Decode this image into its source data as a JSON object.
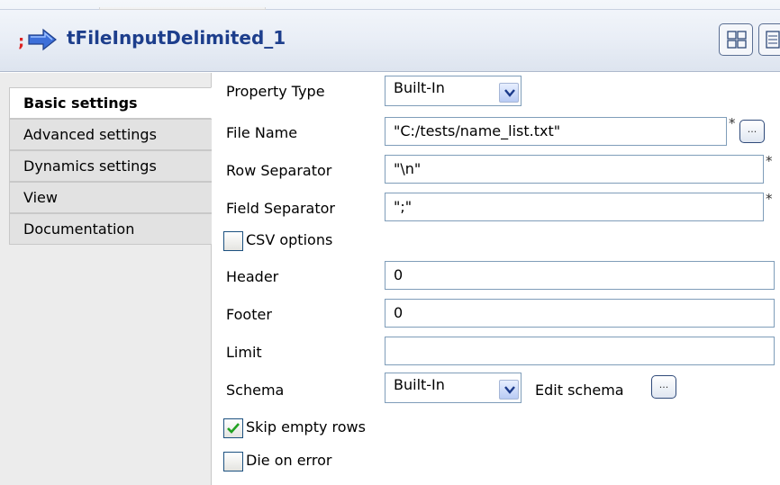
{
  "component": {
    "title": "tFileInputDelimited_1",
    "icon": "file-input-delimited-icon"
  },
  "nav": {
    "items": [
      {
        "label": "Basic settings",
        "active": true
      },
      {
        "label": "Advanced settings",
        "active": false
      },
      {
        "label": "Dynamics settings",
        "active": false
      },
      {
        "label": "View",
        "active": false
      },
      {
        "label": "Documentation",
        "active": false
      }
    ]
  },
  "form": {
    "property_type": {
      "label": "Property Type",
      "value": "Built-In"
    },
    "file_name": {
      "label": "File Name",
      "value": "\"C:/tests/name_list.txt\"",
      "required": "*",
      "browse": "..."
    },
    "row_separator": {
      "label": "Row Separator",
      "value": "\"\\n\"",
      "required": "*"
    },
    "field_separator": {
      "label": "Field Separator",
      "value": "\";\"",
      "required": "*"
    },
    "csv_options": {
      "label": "CSV options",
      "checked": false
    },
    "header": {
      "label": "Header",
      "value": "0"
    },
    "footer": {
      "label": "Footer",
      "value": "0"
    },
    "limit": {
      "label": "Limit",
      "value": ""
    },
    "schema": {
      "label": "Schema",
      "value": "Built-In",
      "edit_label": "Edit schema",
      "edit_button": "..."
    },
    "skip_empty_rows": {
      "label": "Skip empty rows",
      "checked": true
    },
    "die_on_error": {
      "label": "Die on error",
      "checked": false
    }
  },
  "colors": {
    "title": "#1d3e8c",
    "field_border": "#7f9db9",
    "check_green": "#21a121"
  }
}
